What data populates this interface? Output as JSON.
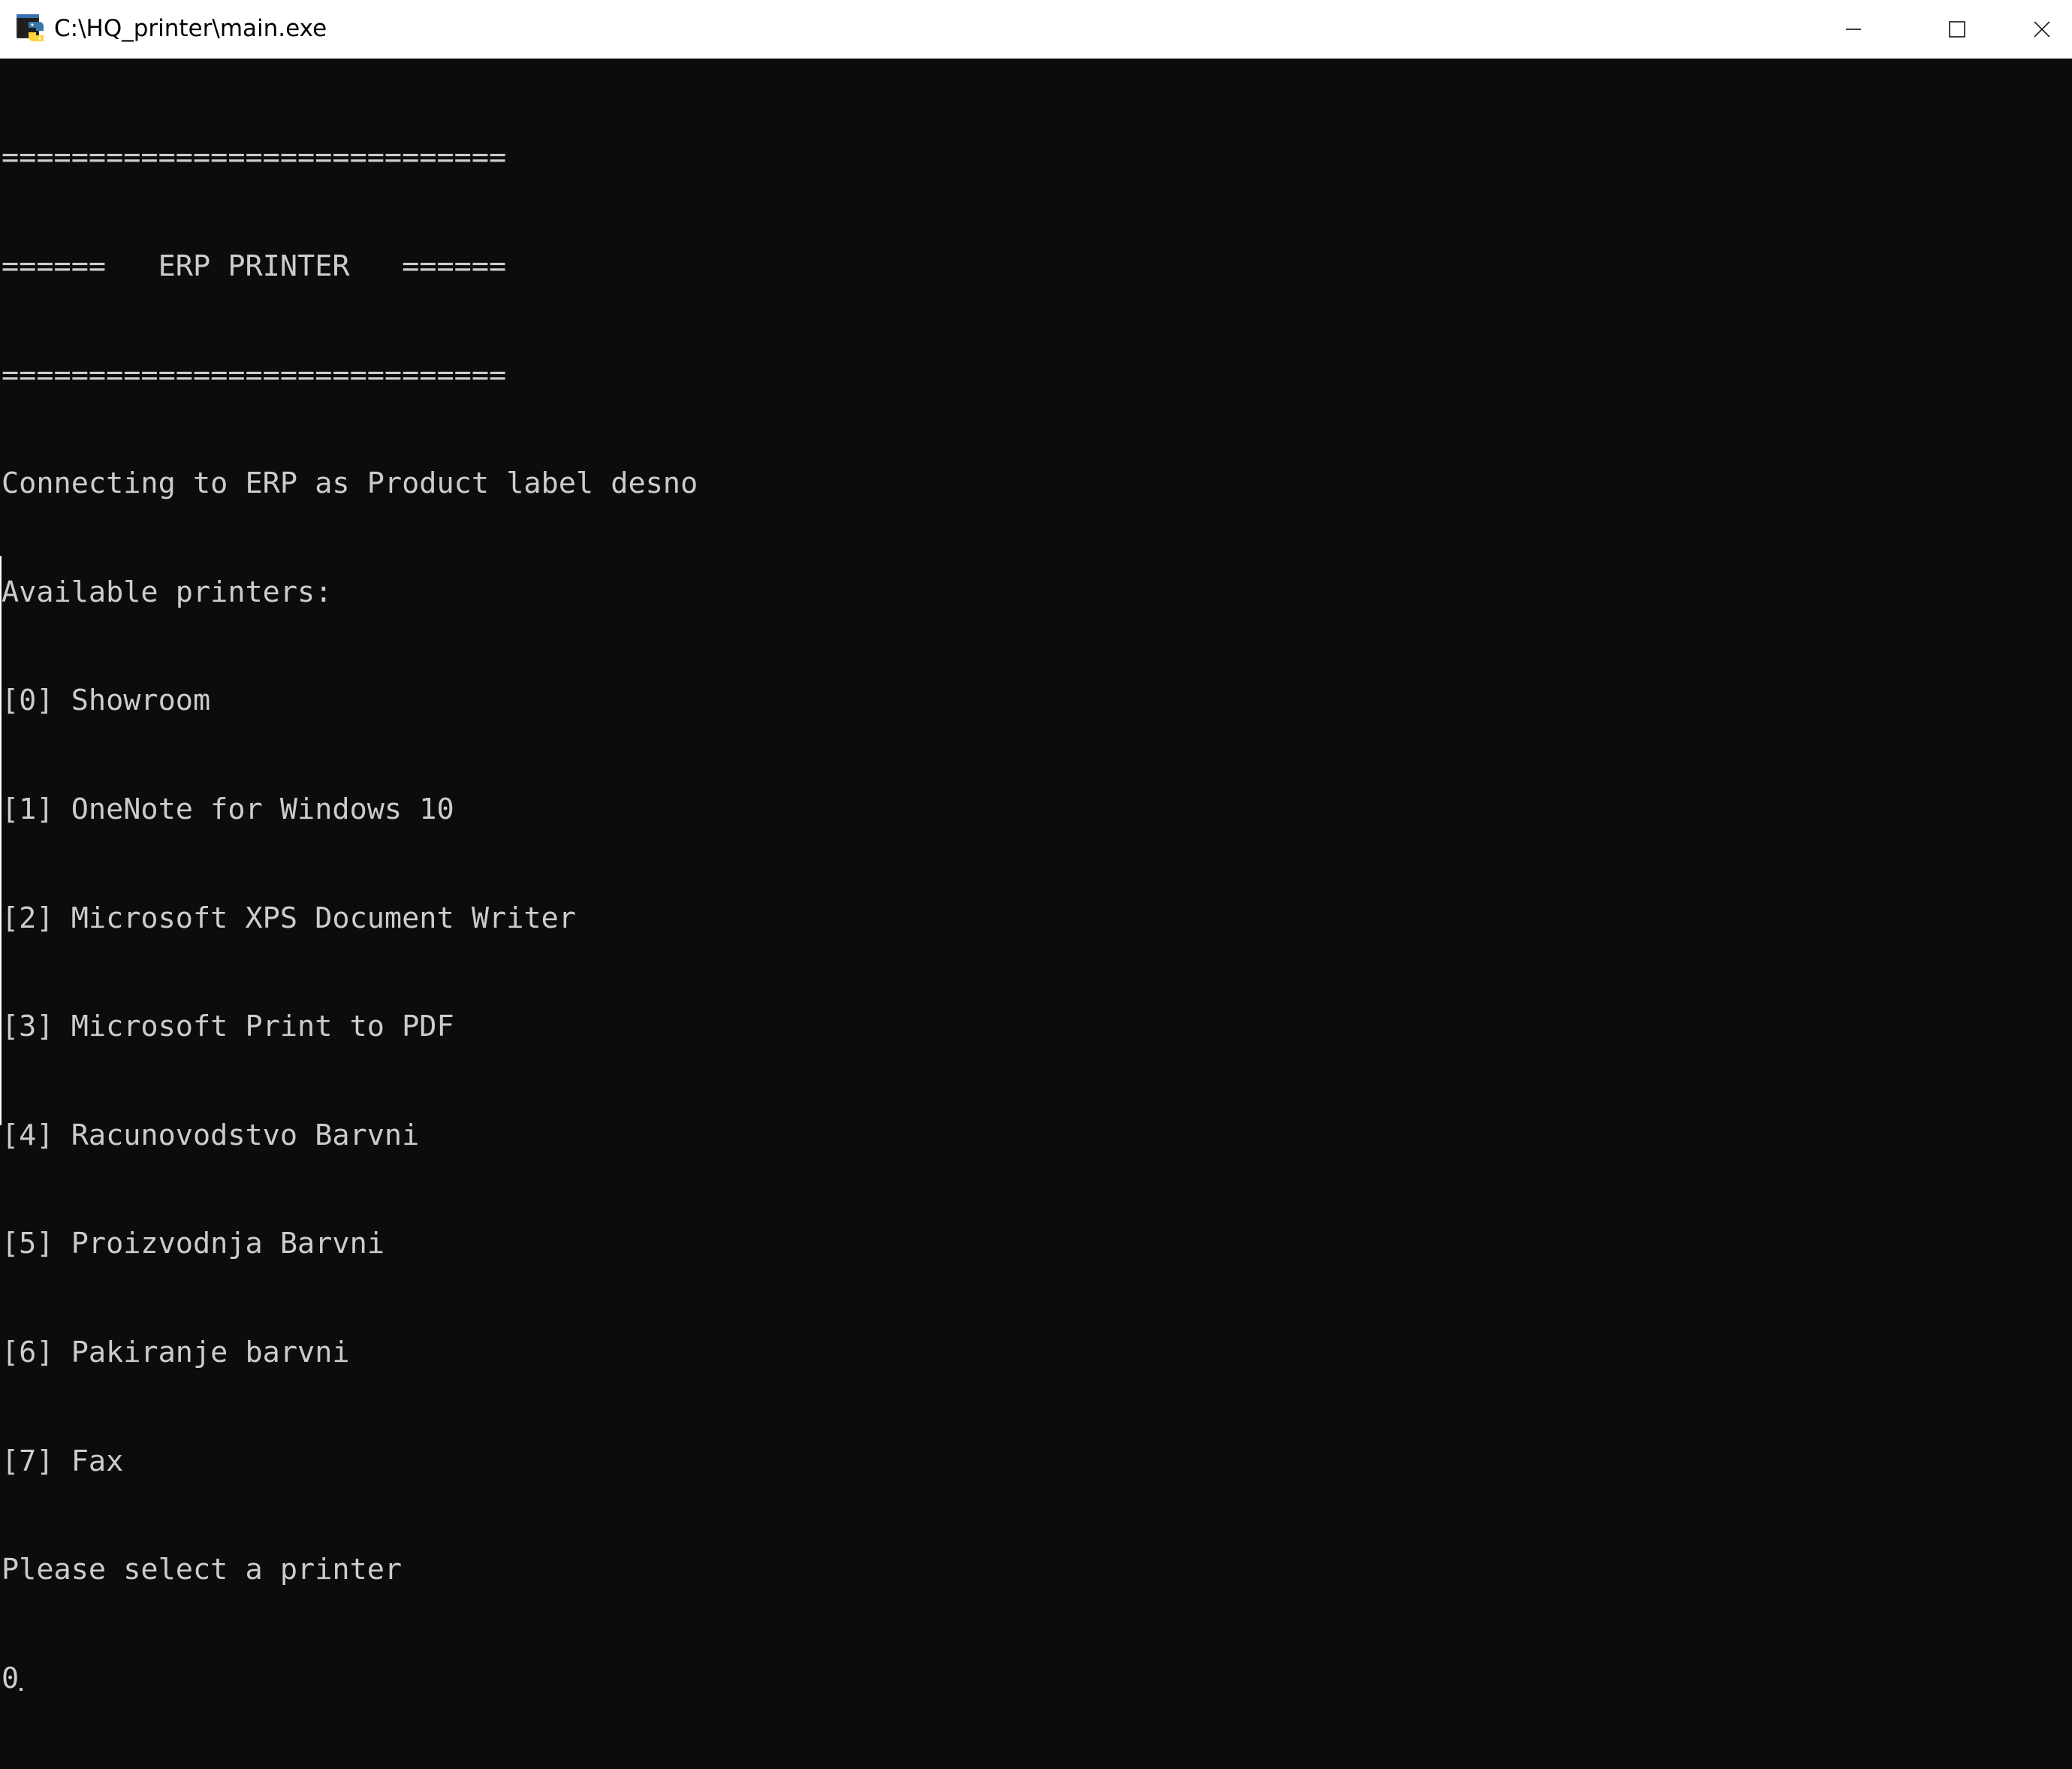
{
  "window": {
    "title": "C:\\HQ_printer\\main.exe",
    "app_icon": "python-console-icon",
    "controls": {
      "minimize_icon": "minimize-icon",
      "maximize_icon": "maximize-icon",
      "close_icon": "close-icon"
    }
  },
  "console": {
    "lines": [
      "=============================",
      "======   ERP PRINTER   ======",
      "=============================",
      "Connecting to ERP as Product label desno",
      "Available printers:",
      "[0] Showroom",
      "[1] OneNote for Windows 10",
      "[2] Microsoft XPS Document Writer",
      "[3] Microsoft Print to PDF",
      "[4] Racunovodstvo Barvni",
      "[5] Proizvodnja Barvni",
      "[6] Pakiranje barvni",
      "[7] Fax",
      "Please select a printer"
    ],
    "input_value": "0",
    "colors": {
      "background": "#0c0c0c",
      "text": "#cccccc"
    }
  }
}
